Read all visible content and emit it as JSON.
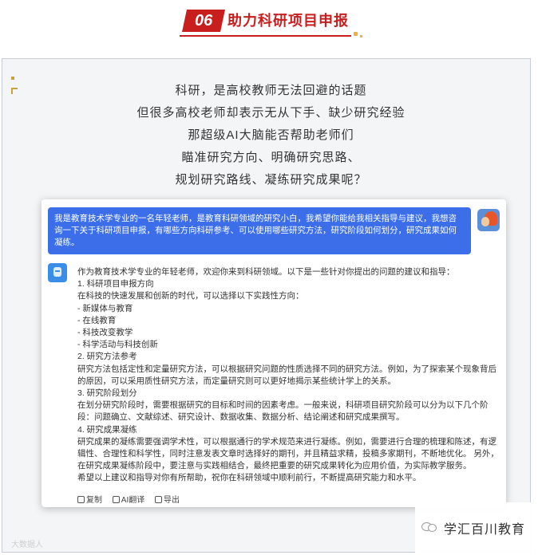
{
  "header": {
    "number": "06",
    "title": "助力科研项目申报"
  },
  "intro": {
    "lines": [
      "科研，是高校教师无法回避的话题",
      "但很多高校老师却表示无从下手、缺少研究经验",
      "那超级AI大脑能否帮助老师们",
      "瞄准研究方向、明确研究思路、",
      "规划研究路线、凝练研究成果呢？"
    ]
  },
  "chat": {
    "user_message": "我是教育技术学专业的一名年轻老师，是教育科研领域的研究小白，我希望你能给我相关指导与建议，我想咨询一下关于科研项目申报，有哪些方向科研参考、可以使用哪些研究方法，研究阶段如何划分，研究成果如何凝练。",
    "ai_response": [
      "作为教育技术学专业的年轻老师，欢迎你来到科研领域。以下是一些针对你提出的问题的建议和指导：",
      "1. 科研项目申报方向",
      "在科技的快速发展和创新的时代，可以选择以下实践性方向：",
      "- 新媒体与教育",
      "- 在线教育",
      "- 科技改变教学",
      "- 科学活动与科技创新",
      "2. 研究方法参考",
      "研究方法包括定性和定量研究方法，可以根据研究问题的性质选择不同的研究方法。例如，为了探索某个现象背后的原因，可以采用质性研究方法，而定量研究则可以更好地揭示某些统计学上的关系。",
      "3. 研究阶段划分",
      "在划分研究阶段时，需要根据研究的目标和时间的因素考虑。一般来说，科研项目研究阶段可以分为以下几个阶段：问题确立、文献综述、研究设计、数据收集、数据分析、结论阐述和研究成果撰写。",
      "4. 研究成果凝练",
      "研究成果的凝练需要强调学术性，可以根据通行的学术规范来进行凝练。例如，需要进行合理的梳理和陈述，有逻辑性、合理性和科学性，同时注意发表文章时选择好的期刊，并且精益求精，投稿多家期刊，不断地优化。 另外，在研究成果凝练阶段中，要注意与实践相结合，最终把重要的研究成果转化为应用价值，为实际教学服务。",
      "希望以上建议和指导对你有所帮助，祝你在科研领域中顺利前行，不断提高研究能力和水平。"
    ],
    "actions": [
      "复制",
      "AI翻译",
      "导出"
    ]
  },
  "watermark": {
    "right": "学汇百川教育",
    "left": "大数据人"
  },
  "colors": {
    "accent_red": "#c81e1e",
    "user_bubble": "#3b6ee8",
    "frame_bg": "#f4f5f7"
  }
}
